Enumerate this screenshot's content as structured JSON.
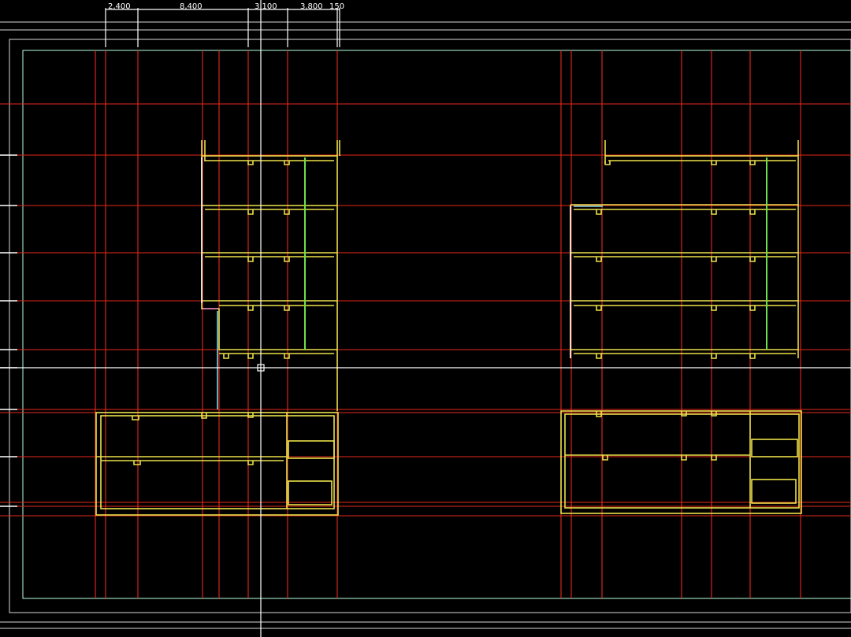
{
  "app": {
    "view": "CAD section drawing"
  },
  "colors": {
    "background": "#000000",
    "grid_axis": "#e8281c",
    "wall_section": "#ece04a",
    "column": "#6ee04a",
    "frame": "#ffffff",
    "cursor": "#ffffff",
    "accent_cyan": "#7fd8e8",
    "accent_magenta": "#e070d0"
  },
  "dimensions": {
    "labels": [
      "2,400",
      "8,400",
      "3,100",
      "3,800",
      "150"
    ]
  },
  "floors": {
    "upper_levels": 4,
    "podium_levels": 2
  },
  "buildings": [
    "left-building-section",
    "right-building-section"
  ]
}
